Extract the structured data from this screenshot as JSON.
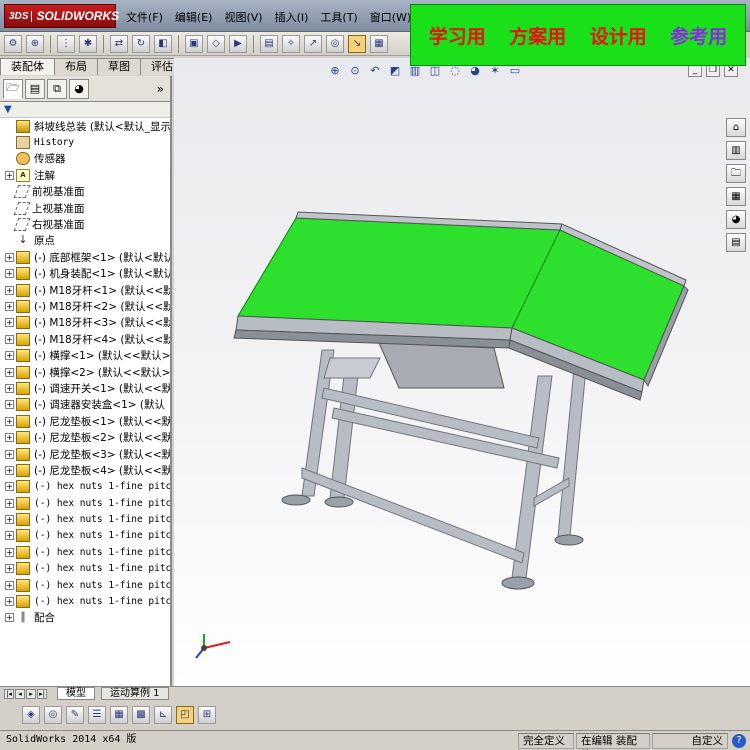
{
  "app": {
    "logo_ds": "3DS",
    "logo_text": "SOLIDWORKS"
  },
  "menu": [
    "文件(F)",
    "编辑(E)",
    "视图(V)",
    "插入(I)",
    "工具(T)",
    "窗口(W)"
  ],
  "banner": [
    "学习用",
    "方案用",
    "设计用",
    "参考用"
  ],
  "command_tabs": [
    "装配体",
    "布局",
    "草图",
    "评估"
  ],
  "feature_tabs_more": "»",
  "filter": "▼",
  "tree": [
    {
      "icon": "root",
      "label": "斜坡线总装  (默认<默认_显示状",
      "exp": ""
    },
    {
      "icon": "hist",
      "label": "History",
      "exp": "",
      "mono": true
    },
    {
      "icon": "sensor",
      "label": "传感器",
      "exp": ""
    },
    {
      "icon": "note",
      "label": "注解",
      "exp": "+"
    },
    {
      "icon": "plane",
      "label": "前视基准面",
      "exp": ""
    },
    {
      "icon": "plane",
      "label": "上视基准面",
      "exp": ""
    },
    {
      "icon": "plane",
      "label": "右视基准面",
      "exp": ""
    },
    {
      "icon": "origin",
      "label": "原点",
      "exp": ""
    },
    {
      "icon": "part",
      "label": "(-) 底部框架<1> (默认<默认",
      "exp": "+"
    },
    {
      "icon": "part",
      "label": "(-) 机身装配<1> (默认<默认",
      "exp": "+"
    },
    {
      "icon": "part",
      "label": "(-) M18牙杆<1> (默认<<默认",
      "exp": "+"
    },
    {
      "icon": "part",
      "label": "(-) M18牙杆<2> (默认<<默认",
      "exp": "+"
    },
    {
      "icon": "part",
      "label": "(-) M18牙杆<3> (默认<<默认",
      "exp": "+"
    },
    {
      "icon": "part",
      "label": "(-) M18牙杆<4> (默认<<默认",
      "exp": "+"
    },
    {
      "icon": "part",
      "label": "(-) 横撑<1> (默认<<默认>_",
      "exp": "+"
    },
    {
      "icon": "part",
      "label": "(-) 横撑<2> (默认<<默认>_",
      "exp": "+"
    },
    {
      "icon": "part",
      "label": "(-) 调速开关<1> (默认<<默",
      "exp": "+"
    },
    {
      "icon": "part",
      "label": "(-) 调速器安装盒<1> (默认",
      "exp": "+"
    },
    {
      "icon": "part",
      "label": "(-) 尼龙垫板<1> (默认<<默",
      "exp": "+"
    },
    {
      "icon": "part",
      "label": "(-) 尼龙垫板<2> (默认<<默",
      "exp": "+"
    },
    {
      "icon": "part",
      "label": "(-) 尼龙垫板<3> (默认<<默",
      "exp": "+"
    },
    {
      "icon": "part",
      "label": "(-) 尼龙垫板<4> (默认<<默",
      "exp": "+"
    },
    {
      "icon": "part",
      "label": "(-) hex nuts 1-fine pitch",
      "exp": "+",
      "mono": true
    },
    {
      "icon": "part",
      "label": "(-) hex nuts 1-fine pitch",
      "exp": "+",
      "mono": true
    },
    {
      "icon": "part",
      "label": "(-) hex nuts 1-fine pitch",
      "exp": "+",
      "mono": true
    },
    {
      "icon": "part",
      "label": "(-) hex nuts 1-fine pitch",
      "exp": "+",
      "mono": true
    },
    {
      "icon": "part",
      "label": "(-) hex nuts 1-fine pitch",
      "exp": "+",
      "mono": true
    },
    {
      "icon": "part",
      "label": "(-) hex nuts 1-fine pitch",
      "exp": "+",
      "mono": true
    },
    {
      "icon": "part",
      "label": "(-) hex nuts 1-fine pitch",
      "exp": "+",
      "mono": true
    },
    {
      "icon": "part",
      "label": "(-) hex nuts 1-fine pitch",
      "exp": "+",
      "mono": true
    },
    {
      "icon": "mates",
      "label": "配合",
      "exp": "+"
    }
  ],
  "bottom_tabs": [
    "模型",
    "运动算例 1"
  ],
  "status": {
    "app": "SolidWorks 2014 x64 版",
    "defined": "完全定义",
    "mode": "在编辑 装配体",
    "custom": "自定义",
    "help": "?"
  },
  "colors": {
    "belt": "#2ee02e",
    "frame": "#b8bcc4",
    "banner_bg": "#19e019",
    "banner_text": "#e81010",
    "banner_last": "#8a2be2"
  }
}
